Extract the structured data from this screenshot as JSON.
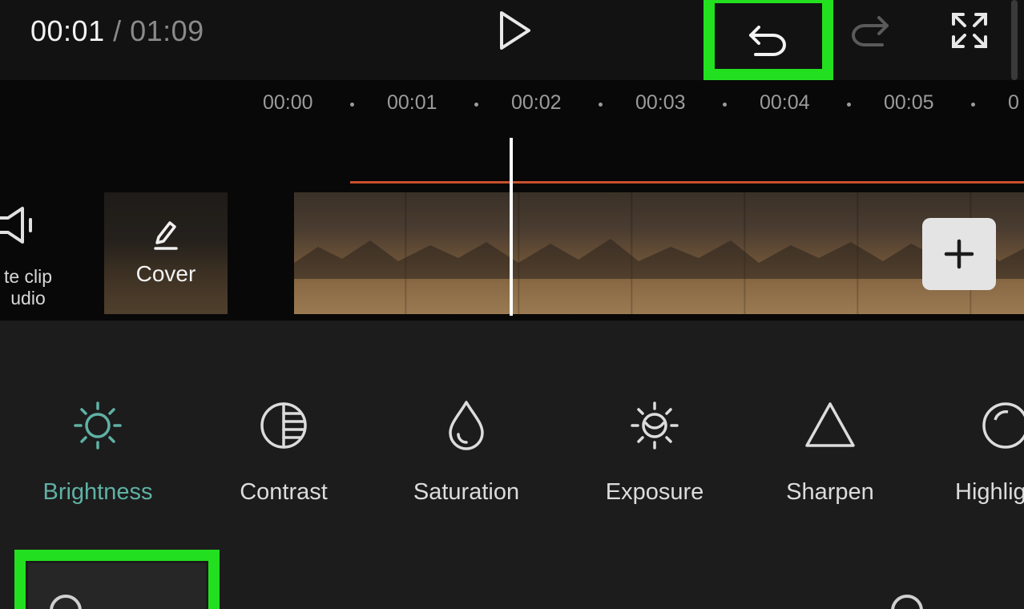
{
  "header": {
    "current_time": "00:01",
    "separator": " / ",
    "duration": "01:09",
    "icons": {
      "play": "play-icon",
      "undo": "undo-icon",
      "redo": "redo-icon",
      "fullscreen": "fullscreen-icon"
    }
  },
  "ruler": {
    "ticks": [
      "00:00",
      "00:01",
      "00:02",
      "00:03",
      "00:04",
      "00:05",
      "0"
    ]
  },
  "track": {
    "mute_label": "te clip\nudio",
    "cover_label": "Cover",
    "add_icon": "plus-icon"
  },
  "adjust": {
    "items": [
      {
        "label": "Brightness",
        "icon": "sun-icon",
        "active": true
      },
      {
        "label": "Contrast",
        "icon": "contrast-icon",
        "active": false
      },
      {
        "label": "Saturation",
        "icon": "droplet-icon",
        "active": false
      },
      {
        "label": "Exposure",
        "icon": "exposure-icon",
        "active": false
      },
      {
        "label": "Sharpen",
        "icon": "triangle-icon",
        "active": false
      },
      {
        "label": "Highlig",
        "icon": "highlight-icon",
        "active": false
      }
    ]
  },
  "colors": {
    "active": "#5fb1a4",
    "highlight": "#22e01f",
    "trim_line": "#c8502e"
  }
}
